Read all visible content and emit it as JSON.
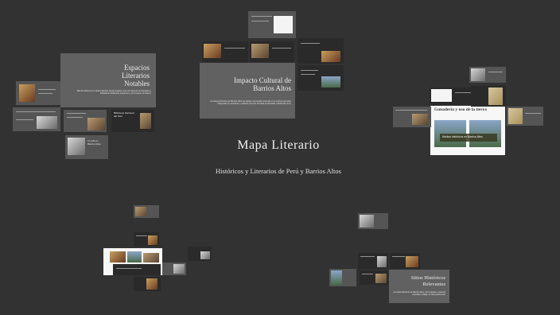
{
  "main": {
    "title": "Mapa Literario",
    "subtitle": "Históricos y Literarios de Perú y Barrios Altos"
  },
  "clusters": {
    "espacios": {
      "title": "Espacios Literarios Notables",
      "body": "Barrios Altos es un núcleo literario donde lugares como la Casa de la Literatura y bibliotecas históricas preservan y promueven la cultura."
    },
    "impacto": {
      "title": "Impacto Cultural de Barrios Altos",
      "body": "La riqueza literaria de Barrios Altos ha dejado una huella profunda en la cultura peruana, influyendo en escritores y artistas que han formado la identidad cultural de Lima."
    },
    "ganaderia": {
      "title": "Ganadería y uso de la tierra",
      "caption": "Medios históricos en Barrios Altos"
    },
    "sitios": {
      "title": "Sitios Históricos Relevantes",
      "body": "Los sitios históricos de Barrios Altos, como iglesias y casonas coloniales, reflejan su valor patrimonial."
    }
  },
  "small_labels": {
    "biblioteca": "Biblioteca Nacional del Perú",
    "vida": "La vida en Barrios Altos"
  }
}
